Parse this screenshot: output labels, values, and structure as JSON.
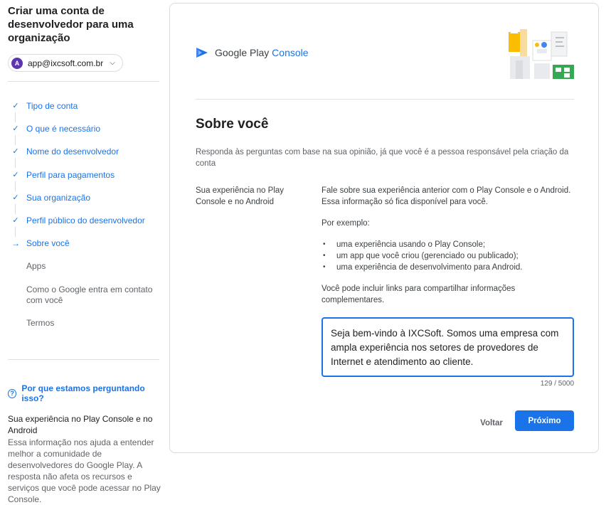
{
  "sidebar": {
    "title": "Criar uma conta de desenvolvedor para uma organização",
    "account": {
      "initial": "A",
      "email": "app@ixcsoft.com.br",
      "avatar_color": "#5e35b1"
    },
    "steps": [
      {
        "label": "Tipo de conta",
        "state": "done"
      },
      {
        "label": "O que é necessário",
        "state": "done"
      },
      {
        "label": "Nome do desenvolvedor",
        "state": "done"
      },
      {
        "label": "Perfil para pagamentos",
        "state": "done"
      },
      {
        "label": "Sua organização",
        "state": "done"
      },
      {
        "label": "Perfil público do desenvolvedor",
        "state": "done"
      },
      {
        "label": "Sobre você",
        "state": "current"
      },
      {
        "label": "Apps",
        "state": "todo"
      },
      {
        "label": "Como o Google entra em contato com você",
        "state": "todo"
      },
      {
        "label": "Termos",
        "state": "todo"
      }
    ],
    "help": {
      "heading": "Por que estamos perguntando isso?",
      "subheading": "Sua experiência no Play Console e no Android",
      "body": "Essa informação nos ajuda a entender melhor a comunidade de desenvolvedores do Google Play. A resposta não afeta os recursos e serviços que você pode acessar no Play Console."
    }
  },
  "main": {
    "brand": {
      "google_play": "Google Play",
      "console": "Console"
    },
    "page_title": "Sobre você",
    "intro": "Responda às perguntas com base na sua opinião, já que você é a pessoa responsável pela criação da conta",
    "question": {
      "label": "Sua experiência no Play Console e no Android",
      "description": "Fale sobre sua experiência anterior com o Play Console e o Android. Essa informação só fica disponível para você.",
      "examples_heading": "Por exemplo:",
      "examples": [
        "uma experiência usando o Play Console;",
        "um app que você criou (gerenciado ou publicado);",
        "uma experiência de desenvolvimento para Android."
      ],
      "links_note": "Você pode incluir links para compartilhar informações complementares.",
      "answer": "Seja bem-vindo à IXCSoft. Somos uma empresa com ampla experiência nos setores de provedores de Internet e atendimento ao cliente.",
      "counter": "129 / 5000"
    },
    "buttons": {
      "back": "Voltar",
      "next": "Próximo"
    }
  },
  "colors": {
    "accent": "#1a73e8",
    "text": "#202124",
    "muted": "#5f6368",
    "border": "#dadce0"
  },
  "icons": [
    "account-avatar",
    "chevron-down-icon",
    "check-icon",
    "arrow-right-icon",
    "help-icon",
    "play-console-logo",
    "illustration"
  ]
}
